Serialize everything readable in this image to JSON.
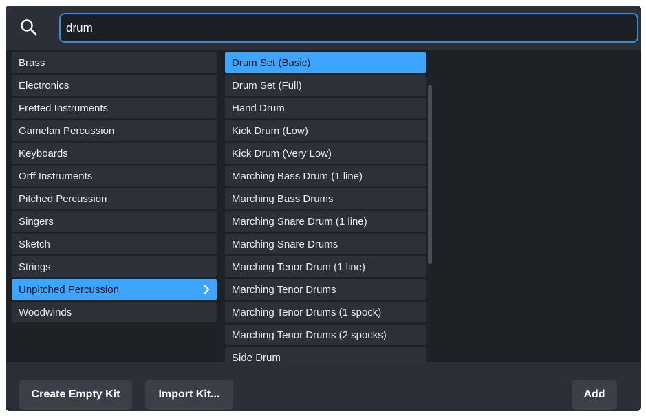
{
  "search": {
    "value": "drum"
  },
  "categories": [
    {
      "label": "Brass",
      "selected": false
    },
    {
      "label": "Electronics",
      "selected": false
    },
    {
      "label": "Fretted Instruments",
      "selected": false
    },
    {
      "label": "Gamelan Percussion",
      "selected": false
    },
    {
      "label": "Keyboards",
      "selected": false
    },
    {
      "label": "Orff Instruments",
      "selected": false
    },
    {
      "label": "Pitched Percussion",
      "selected": false
    },
    {
      "label": "Singers",
      "selected": false
    },
    {
      "label": "Sketch",
      "selected": false
    },
    {
      "label": "Strings",
      "selected": false
    },
    {
      "label": "Unpitched Percussion",
      "selected": true
    },
    {
      "label": "Woodwinds",
      "selected": false
    }
  ],
  "instruments": [
    {
      "label": "Drum Set (Basic)",
      "selected": true
    },
    {
      "label": "Drum Set (Full)",
      "selected": false
    },
    {
      "label": "Hand Drum",
      "selected": false
    },
    {
      "label": "Kick Drum (Low)",
      "selected": false
    },
    {
      "label": "Kick Drum (Very Low)",
      "selected": false
    },
    {
      "label": "Marching Bass Drum (1 line)",
      "selected": false
    },
    {
      "label": "Marching Bass Drums",
      "selected": false
    },
    {
      "label": "Marching Snare Drum (1 line)",
      "selected": false
    },
    {
      "label": "Marching Snare Drums",
      "selected": false
    },
    {
      "label": "Marching Tenor Drum (1 line)",
      "selected": false
    },
    {
      "label": "Marching Tenor Drums",
      "selected": false
    },
    {
      "label": "Marching Tenor Drums (1 spock)",
      "selected": false
    },
    {
      "label": "Marching Tenor Drums (2 spocks)",
      "selected": false
    },
    {
      "label": "Side Drum",
      "selected": false
    }
  ],
  "buttons": {
    "create_empty_kit": "Create Empty Kit",
    "import_kit": "Import Kit...",
    "add": "Add"
  },
  "colors": {
    "accent": "#3ea5ff",
    "background": "#1e2227",
    "row": "#2c3138",
    "button": "#3b4047"
  },
  "icons": {
    "search": "search-icon",
    "expand": "chevron-right-icon"
  }
}
